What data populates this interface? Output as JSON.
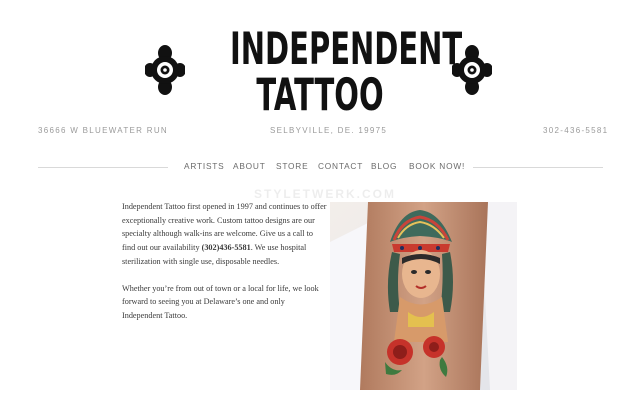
{
  "brand": {
    "line1": "INDEPENDENT",
    "line2": "TATTOO"
  },
  "info": {
    "address": "36666 W BLUEWATER RUN",
    "city": "SELBYVILLE, DE. 19975",
    "phone": "302-436-5581"
  },
  "nav": {
    "items": [
      {
        "label": "ARTISTS"
      },
      {
        "label": "ABOUT"
      },
      {
        "label": "STORE"
      },
      {
        "label": "CONTACT"
      },
      {
        "label": "BLOG"
      },
      {
        "label": "BOOK NOW!"
      }
    ]
  },
  "watermark": "STYLETWERK.COM",
  "content": {
    "p1_part1": "Independent Tattoo first opened in 1997 and continues to offer exceptionally creative work. Custom tattoo designs are our specialty although walk-ins are welcome. Give us a call to find out our availability ",
    "p1_phone": "(302)436-5581",
    "p1_part2": ". We use hospital sterilization with single use, disposable needles.",
    "p2": "Whether you’re from out of town or a local for life, we look forward to seeing you at Delaware’s one and only Independent Tattoo."
  },
  "colors": {
    "background": "#ffffff",
    "text": "#3a3a3a",
    "muted": "#9a9a9a",
    "logo": "#111111"
  }
}
